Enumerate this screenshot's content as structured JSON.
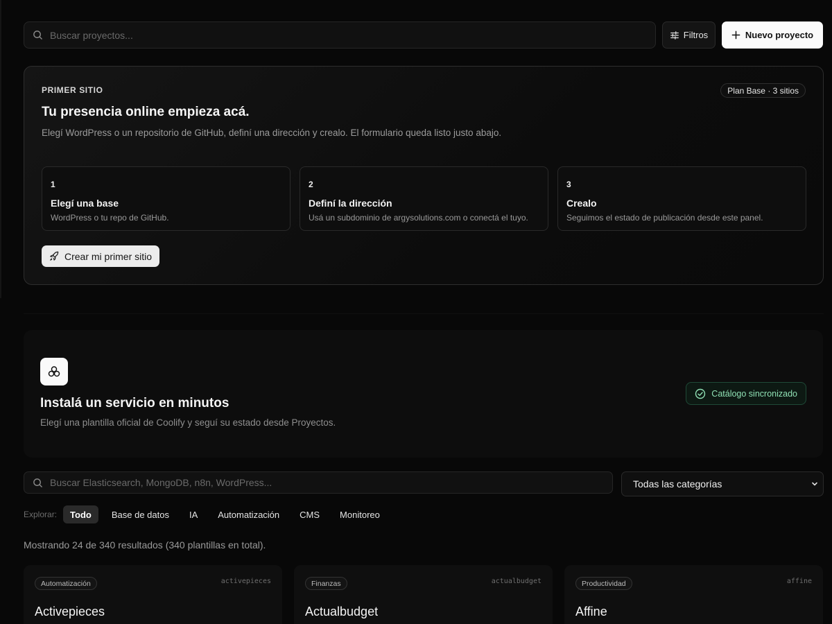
{
  "top": {
    "search_placeholder": "Buscar proyectos...",
    "filters_label": "Filtros",
    "new_project_label": "Nuevo proyecto"
  },
  "first_site": {
    "eyebrow": "PRIMER SITIO",
    "plan_badge": "Plan Base · 3 sitios",
    "title": "Tu presencia online empieza acá.",
    "description": "Elegí WordPress o un repositorio de GitHub, definí una dirección y crealo. El formulario queda listo justo abajo.",
    "steps": [
      {
        "number": "1",
        "title": "Elegí una base",
        "description": "WordPress o tu repo de GitHub."
      },
      {
        "number": "2",
        "title": "Definí la dirección",
        "description": "Usá un subdominio de argysolutions.com o conectá el tuyo."
      },
      {
        "number": "3",
        "title": "Crealo",
        "description": "Seguimos el estado de publicación desde este panel."
      }
    ],
    "cta_label": "Crear mi primer sitio"
  },
  "services": {
    "title": "Instalá un servicio en minutos",
    "description": "Elegí una plantilla oficial de Coolify y seguí su estado desde Proyectos.",
    "sync_badge": "Catálogo sincronizado",
    "accent_color": "#8fe0b4"
  },
  "catalog": {
    "search_placeholder": "Buscar Elasticsearch, MongoDB, n8n, WordPress...",
    "category_selected": "Todas las categorías",
    "explore_label": "Explorar:",
    "chips": [
      "Todo",
      "Base de datos",
      "IA",
      "Automatización",
      "CMS",
      "Monitoreo"
    ],
    "active_chip": "Todo",
    "results_text": "Mostrando 24 de 340 resultados (340 plantillas en total).",
    "cards": [
      {
        "tag": "Automatización",
        "slug": "activepieces",
        "name": "Activepieces"
      },
      {
        "tag": "Finanzas",
        "slug": "actualbudget",
        "name": "Actualbudget"
      },
      {
        "tag": "Productividad",
        "slug": "affine",
        "name": "Affine"
      }
    ]
  }
}
